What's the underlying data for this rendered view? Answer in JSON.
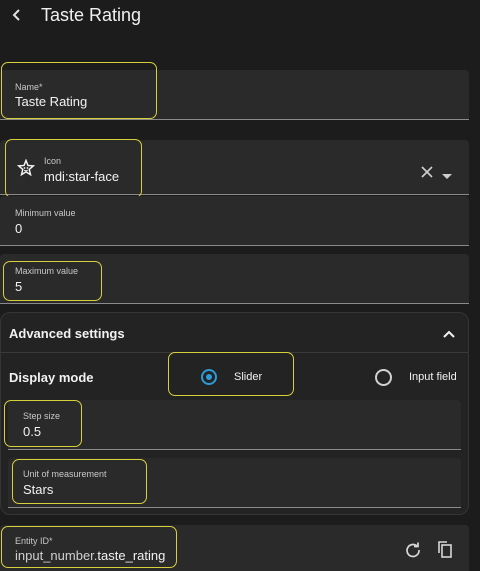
{
  "header": {
    "title": "Taste Rating"
  },
  "fields": {
    "name": {
      "label": "Name*",
      "value": "Taste Rating"
    },
    "icon": {
      "label": "Icon",
      "value": "mdi:star-face"
    },
    "min": {
      "label": "Minimum value",
      "value": "0"
    },
    "max": {
      "label": "Maximum value",
      "value": "5"
    },
    "step": {
      "label": "Step size",
      "value": "0.5"
    },
    "unit": {
      "label": "Unit of measurement",
      "value": "Stars"
    },
    "entity": {
      "label": "Entity ID*",
      "value_prefix": "input_number.",
      "value_suffix": "taste_rating"
    }
  },
  "advanced": {
    "title": "Advanced settings",
    "display_mode_label": "Display mode",
    "options": {
      "slider": "Slider",
      "input_field": "Input field"
    },
    "selected": "Slider"
  },
  "icons": {
    "back": "back-arrow-icon",
    "field_icon": "star-face-icon",
    "clear": "close-icon",
    "dropdown": "caret-down-icon",
    "collapse": "chevron-up-icon",
    "regenerate": "refresh-icon",
    "copy": "copy-icon"
  },
  "colors": {
    "background": "#1c1c1c",
    "field_bg": "#2a2a2a",
    "accent": "#2c9bd6",
    "highlight": "#d8cf3c"
  }
}
